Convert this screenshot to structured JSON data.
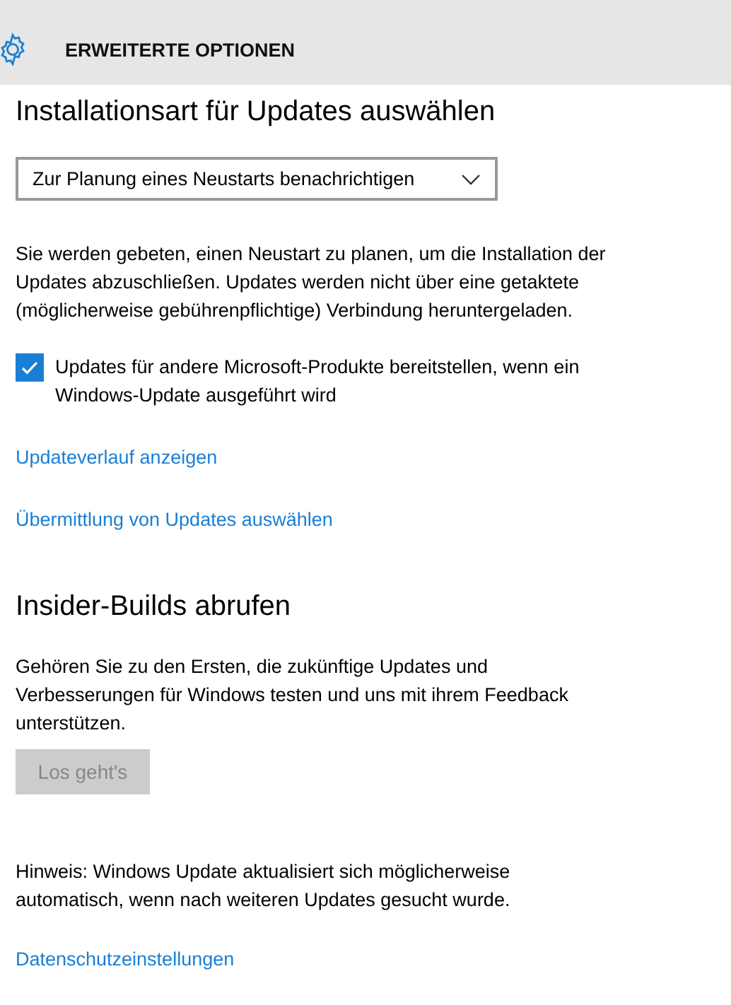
{
  "header": {
    "title": "ERWEITERTE OPTIONEN"
  },
  "install_section": {
    "heading": "Installationsart für Updates auswählen",
    "dropdown": {
      "value": "Zur Planung eines Neustarts benachrichtigen"
    },
    "description": "Sie werden gebeten, einen Neustart zu planen, um die Installation der Updates abzuschließen. Updates werden nicht über eine getaktete (möglicherweise gebührenpflichtige) Verbindung heruntergeladen.",
    "checkbox": {
      "label": "Updates für andere Microsoft-Produkte bereitstellen, wenn ein Windows-Update ausgeführt wird",
      "checked": true
    },
    "links": [
      "Updateverlauf anzeigen",
      "Übermittlung von Updates auswählen"
    ]
  },
  "insider_section": {
    "heading": "Insider-Builds abrufen",
    "description": "Gehören Sie zu den Ersten, die zukünftige Updates und Verbesserungen für Windows testen und uns mit ihrem Feedback unterstützen.",
    "button": {
      "label": "Los geht's",
      "disabled": true
    }
  },
  "note": "Hinweis: Windows Update aktualisiert sich möglicherweise automatisch, wenn nach weiteren Updates gesucht wurde.",
  "footer_link": "Datenschutzeinstellungen"
}
